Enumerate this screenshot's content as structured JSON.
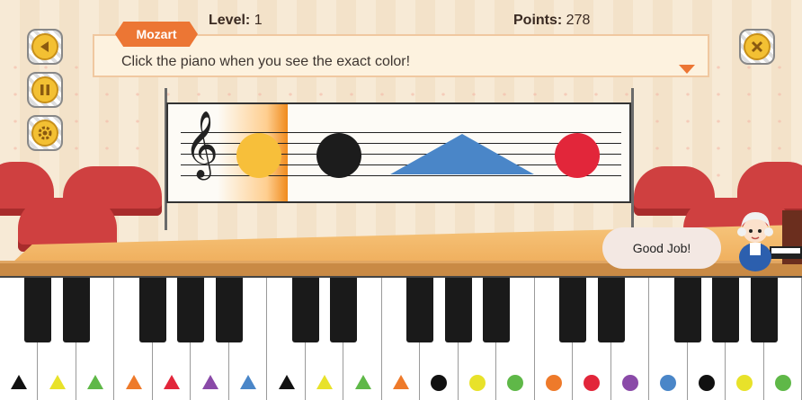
{
  "hud": {
    "level_label": "Level:",
    "level_value": "1",
    "points_label": "Points:",
    "points_value": "278"
  },
  "dialog": {
    "speaker": "Mozart",
    "message": "Click the piano when you see the exact color!"
  },
  "feedback": "Good Job!",
  "buttons": {
    "back_icon": "left-arrow",
    "pause_icon": "pause",
    "settings_icon": "gear",
    "close_icon": "cross"
  },
  "sheet": {
    "notes": [
      {
        "shape": "circle",
        "color": "#f7bf3a"
      },
      {
        "shape": "circle",
        "color": "#1c1c1c"
      },
      {
        "shape": "triangle",
        "color": "#4a86c8"
      },
      {
        "shape": "circle",
        "color": "#e2263a"
      }
    ]
  },
  "keys": [
    {
      "shape": "triangle",
      "color": "#111111"
    },
    {
      "shape": "triangle",
      "color": "#e8e22a"
    },
    {
      "shape": "triangle",
      "color": "#5fb848"
    },
    {
      "shape": "triangle",
      "color": "#ee7a2a"
    },
    {
      "shape": "triangle",
      "color": "#e2263a"
    },
    {
      "shape": "triangle",
      "color": "#8a4aa8"
    },
    {
      "shape": "triangle",
      "color": "#4a86c8"
    },
    {
      "shape": "triangle",
      "color": "#111111"
    },
    {
      "shape": "triangle",
      "color": "#e8e22a"
    },
    {
      "shape": "triangle",
      "color": "#5fb848"
    },
    {
      "shape": "triangle",
      "color": "#ee7a2a"
    },
    {
      "shape": "circle",
      "color": "#111111"
    },
    {
      "shape": "circle",
      "color": "#e8e22a"
    },
    {
      "shape": "circle",
      "color": "#5fb848"
    },
    {
      "shape": "circle",
      "color": "#ee7a2a"
    },
    {
      "shape": "circle",
      "color": "#e2263a"
    },
    {
      "shape": "circle",
      "color": "#8a4aa8"
    },
    {
      "shape": "circle",
      "color": "#4a86c8"
    },
    {
      "shape": "circle",
      "color": "#111111"
    },
    {
      "shape": "circle",
      "color": "#e8e22a"
    },
    {
      "shape": "circle",
      "color": "#5fb848"
    }
  ]
}
